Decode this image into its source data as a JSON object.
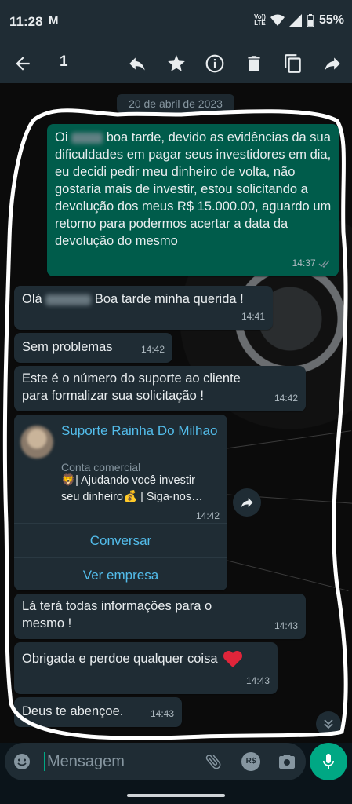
{
  "status": {
    "time": "11:28",
    "notif": "M",
    "lte_top": "Vo))",
    "lte_bottom": "LTE",
    "battery": "55%"
  },
  "appbar": {
    "selected_count": "1"
  },
  "chat": {
    "date": "20 de abril de 2023",
    "messages": [
      {
        "dir": "out",
        "pre": "Oi",
        "text": "boa tarde, devido as evidências da sua dificuldades em pagar seus investidores em dia, eu decidi pedir meu dinheiro de volta, não gostaria mais de investir, estou solicitando a devolução dos meus R$ 15.000.00, aguardo um retorno para podermos acertar a data da devolução do mesmo",
        "time": "14:37"
      },
      {
        "dir": "in",
        "pre": "Olá",
        "text": "Boa tarde minha querida !",
        "time": "14:41"
      },
      {
        "dir": "in",
        "text": "Sem problemas",
        "time": "14:42"
      },
      {
        "dir": "in",
        "text": "Este é o número do suporte ao cliente para formalizar sua solicitação !",
        "time": "14:42"
      },
      {
        "dir": "in",
        "text": "Lá terá todas informações para o mesmo !",
        "time": "14:43"
      },
      {
        "dir": "in",
        "text": "Obrigada e perdoe qualquer coisa",
        "emoji": "❤️",
        "time": "14:43"
      },
      {
        "dir": "in",
        "text": "Deus te abençoe.",
        "time": "14:43"
      }
    ],
    "contact_card": {
      "name": "Suporte Rainha Do Milhao",
      "type": "Conta comercial",
      "desc_icon": "🦁",
      "desc_line1": "| Ajudando você investir",
      "desc_line2": "seu dinheiro",
      "desc_emoji2": "💰",
      "desc_line2b": "| Siga-nos…",
      "time": "14:42",
      "btn_chat": "Conversar",
      "btn_business": "Ver empresa"
    }
  },
  "composer": {
    "placeholder": "Mensagem",
    "payment_label": "R$"
  },
  "colors": {
    "accent": "#00a884",
    "outgoing": "#005c4b",
    "incoming": "#1f2c34",
    "link": "#53bdeb"
  }
}
